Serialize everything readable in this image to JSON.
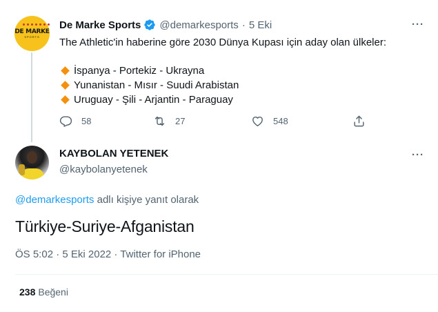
{
  "tweet1": {
    "avatar_brand": "DE MARKE",
    "avatar_sub": "SPORTS",
    "name": "De Marke Sports",
    "handle": "@demarkesports",
    "date": "5 Eki",
    "text": "The Athletic'in haberine göre 2030 Dünya Kupası için aday olan ülkeler:",
    "list": [
      "İspanya - Portekiz - Ukrayna",
      "Yunanistan - Mısır - Suudi Arabistan",
      "Uruguay - Şili - Arjantin - Paraguay"
    ],
    "actions": {
      "replies": "58",
      "retweets": "27",
      "likes": "548"
    },
    "more": "···"
  },
  "tweet2": {
    "name": "KAYBOLAN YETENEK",
    "handle": "@kaybolanyetenek",
    "more": "···",
    "reply_mention": "@demarkesports",
    "reply_suffix": " adlı kişiye yanıt olarak",
    "text": "Türkiye-Suriye-Afganistan",
    "meta": "ÖS 5:02 · 5 Eki 2022 · Twitter for iPhone",
    "likes_count": "238",
    "likes_label": "Beğeni"
  },
  "colors": {
    "accent": "#1d9bf0",
    "muted": "#536471",
    "bullet": "#f4900c",
    "brand_yellow": "#f6c21b"
  },
  "icons": {
    "verified": "verified-badge-icon",
    "reply": "reply-icon",
    "retweet": "retweet-icon",
    "like": "heart-icon",
    "share": "share-icon"
  }
}
